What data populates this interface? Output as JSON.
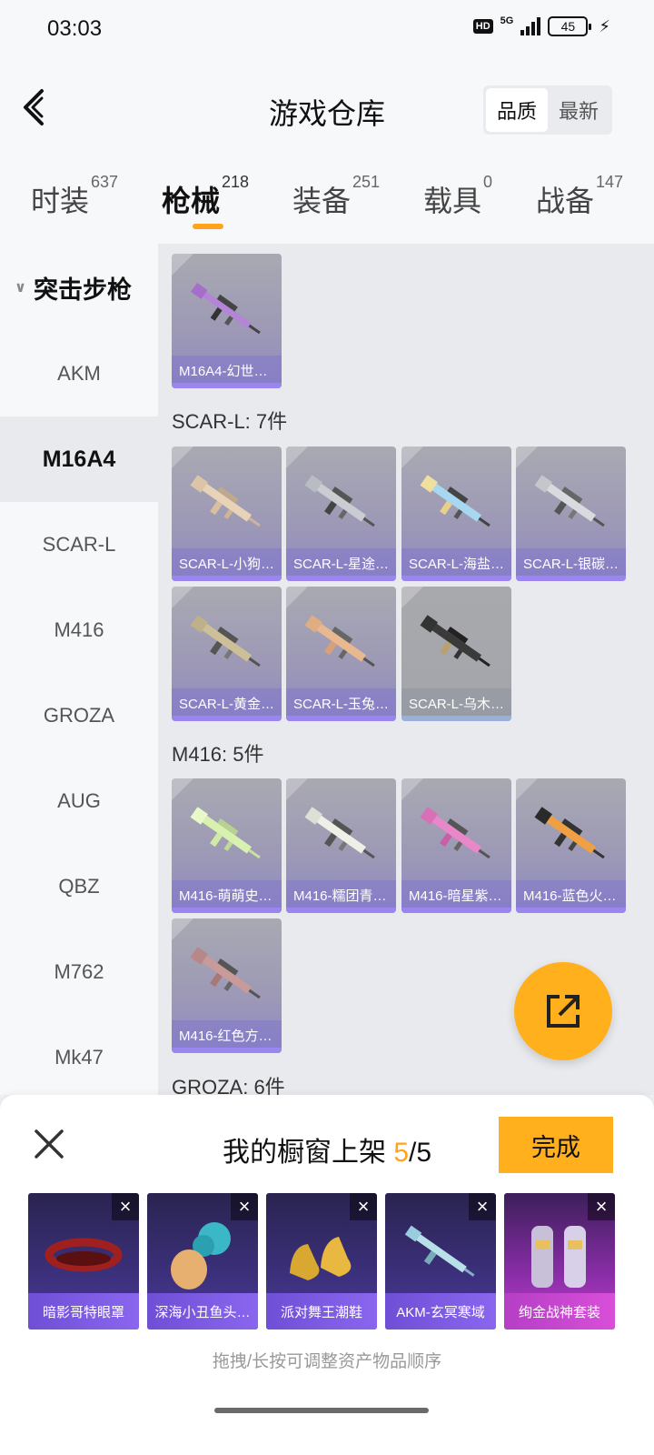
{
  "status_bar": {
    "time": "03:03",
    "hd": "HD",
    "network": "5G",
    "battery": "45"
  },
  "header": {
    "title": "游戏仓库",
    "sort": [
      "品质",
      "最新"
    ]
  },
  "tabs": [
    {
      "label": "时装",
      "count": "637"
    },
    {
      "label": "枪械",
      "count": "218"
    },
    {
      "label": "装备",
      "count": "251"
    },
    {
      "label": "载具",
      "count": "0"
    },
    {
      "label": "战备",
      "count": "147"
    }
  ],
  "sidebar": {
    "group": "突击步枪",
    "items": [
      "AKM",
      "M16A4",
      "SCAR-L",
      "M416",
      "GROZA",
      "AUG",
      "QBZ",
      "M762",
      "Mk47"
    ]
  },
  "content": {
    "m16_cards": [
      "M16A4-幻世…"
    ],
    "scar_title": "SCAR-L: 7件",
    "scar_cards": [
      "SCAR-L-小狗…",
      "SCAR-L-星途…",
      "SCAR-L-海盐…",
      "SCAR-L-银碳…",
      "SCAR-L-黄金…",
      "SCAR-L-玉兔…",
      "SCAR-L-乌木…"
    ],
    "m416_title": "M416: 5件",
    "m416_cards": [
      "M416-萌萌史…",
      "M416-糯团青…",
      "M416-暗星紫…",
      "M416-蓝色火…",
      "M416-红色方…"
    ],
    "groza_title": "GROZA: 6件"
  },
  "panel": {
    "title_prefix": "我的橱窗上架 ",
    "current": "5",
    "total": "/5",
    "done": "完成",
    "items": [
      "暗影哥特眼罩",
      "深海小丑鱼头…",
      "派对舞王潮鞋",
      "AKM-玄冥寒域",
      "绚金战神套装"
    ],
    "remove_symbol": "×",
    "hint": "拖拽/长按可调整资产物品顺序"
  },
  "colors": {
    "accent": "#ffa31a",
    "card_purple": "#9b86f0",
    "legendary": "#d84fd8"
  }
}
